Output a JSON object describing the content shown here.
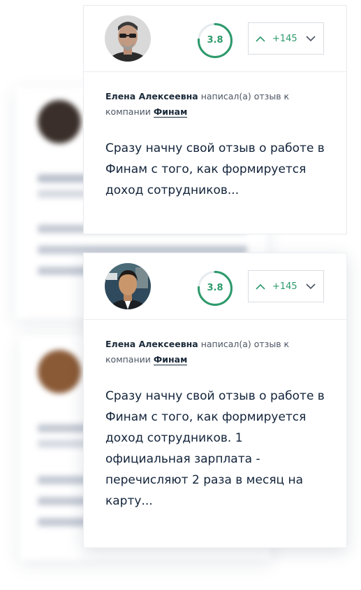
{
  "cards": [
    {
      "rating": "3.8",
      "rating_fraction": 0.76,
      "vote_count": "+145",
      "author": "Елена Алексеевна",
      "action_text": "написал(а) отзыв к компании",
      "company": "Финам",
      "review": "Сразу начну свой отзыв о работе в Финам с того, как формируется доход сотрудников..."
    },
    {
      "rating": "3.8",
      "rating_fraction": 0.76,
      "vote_count": "+145",
      "author": "Елена Алексеевна",
      "action_text": "написал(а) отзыв к компании",
      "company": "Финам",
      "review": "Сразу начну свой отзыв о работе в Финам с того, как формируется доход сотрудников. 1 официальная зарплата - перечисляют 2 раза в месяц на карту..."
    }
  ],
  "colors": {
    "accent_green": "#2d9a6b",
    "ring_track": "#e6ebef",
    "text_dark": "#12233a",
    "border": "#e7eaee"
  }
}
